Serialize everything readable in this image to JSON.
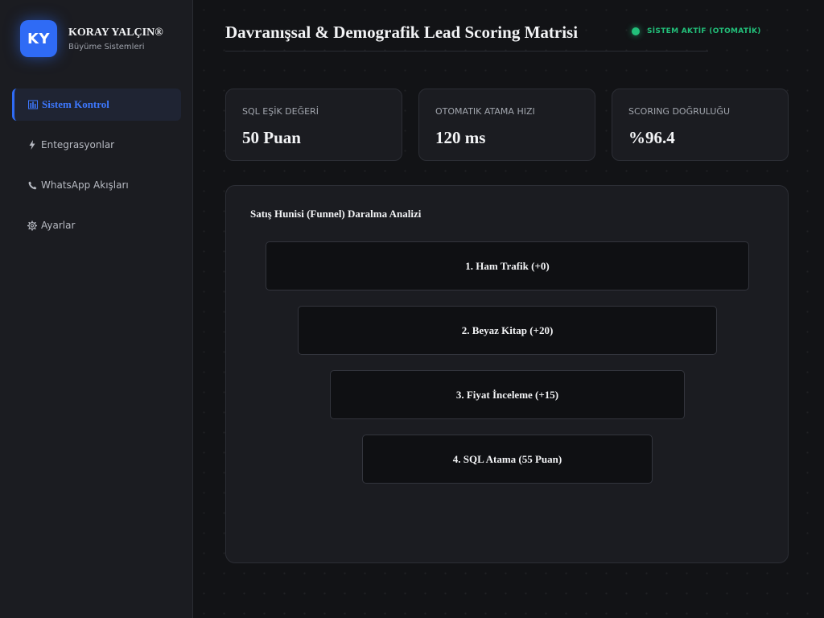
{
  "brand": {
    "logo_text": "KY",
    "name": "KORAY YALÇIN®",
    "subtitle": "Büyüme Sistemleri"
  },
  "sidebar": {
    "items": [
      {
        "icon": "dashboard-icon",
        "glyph": "📊",
        "label": "Sistem Kontrol",
        "active": true
      },
      {
        "icon": "lightning-icon",
        "glyph": "⚡",
        "label": "Entegrasyonlar",
        "active": false
      },
      {
        "icon": "phone-icon",
        "glyph": "📞",
        "label": "WhatsApp Akışları",
        "active": false
      },
      {
        "icon": "gear-icon",
        "glyph": "⚙",
        "label": "Ayarlar",
        "active": false
      }
    ]
  },
  "header": {
    "title": "Davranışsal & Demografik Lead Scoring Matrisi",
    "status_text": "SİSTEM AKTİF (OTOMATİK)",
    "status_color": "#22c07a"
  },
  "stats": [
    {
      "label": "SQL EŞİK DEĞERİ",
      "value": "50 Puan"
    },
    {
      "label": "OTOMATIK ATAMA HIZI",
      "value": "120 ms"
    },
    {
      "label": "SCORING DOĞRULUĞU",
      "value": "%96.4"
    }
  ],
  "funnel": {
    "title": "Satış Hunisi (Funnel) Daralma Analizi",
    "stages": [
      {
        "label": "1. Ham Trafik (+0)"
      },
      {
        "label": "2. Beyaz Kitap (+20)"
      },
      {
        "label": "3. Fiyat İnceleme (+15)"
      },
      {
        "label": "4. SQL Atama (55 Puan)"
      }
    ]
  },
  "colors": {
    "accent": "#2f6bf5",
    "background": "#121316",
    "panel": "#1b1c21"
  }
}
